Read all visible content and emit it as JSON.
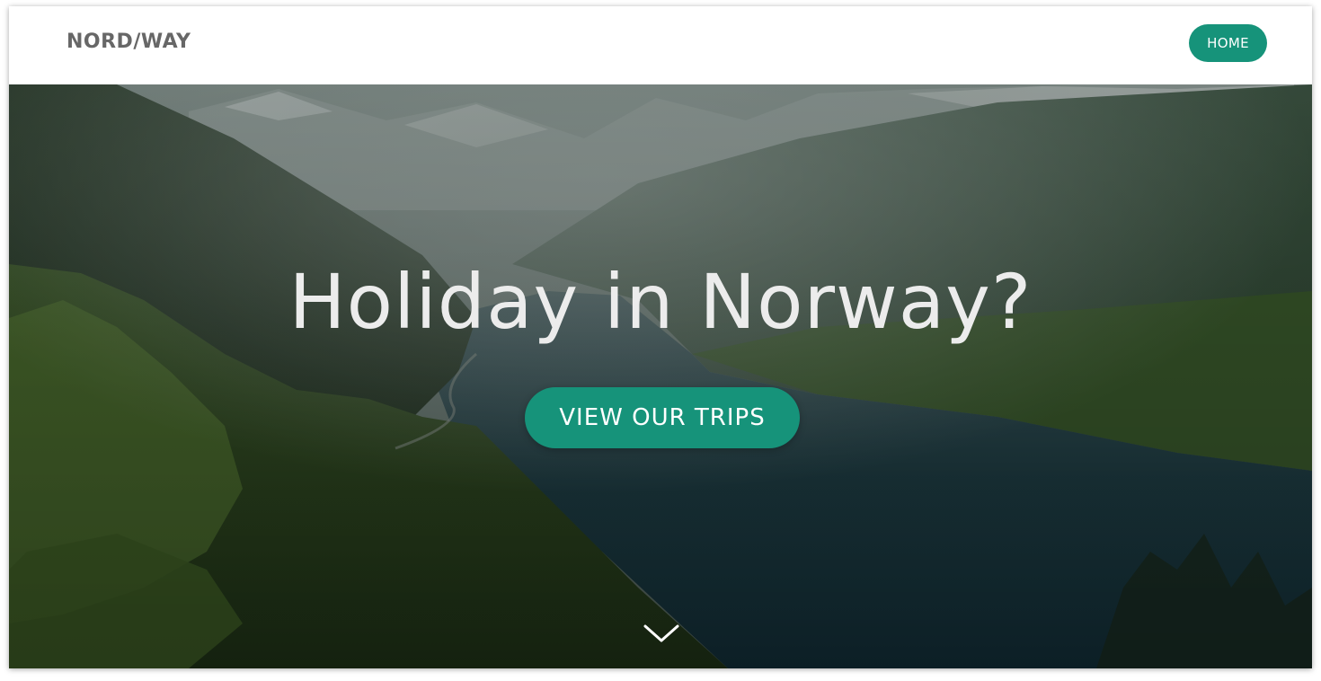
{
  "header": {
    "brand": "NORD/WAY",
    "nav": [
      {
        "label": "HOME"
      }
    ]
  },
  "hero": {
    "title": "Holiday in Norway?",
    "cta_label": "VIEW OUR TRIPS",
    "scroll_icon": "chevron-down-icon",
    "background": "fjord-landscape-photo"
  },
  "colors": {
    "accent": "#16937a",
    "brand_text": "#676767",
    "hero_text": "#ececec"
  }
}
